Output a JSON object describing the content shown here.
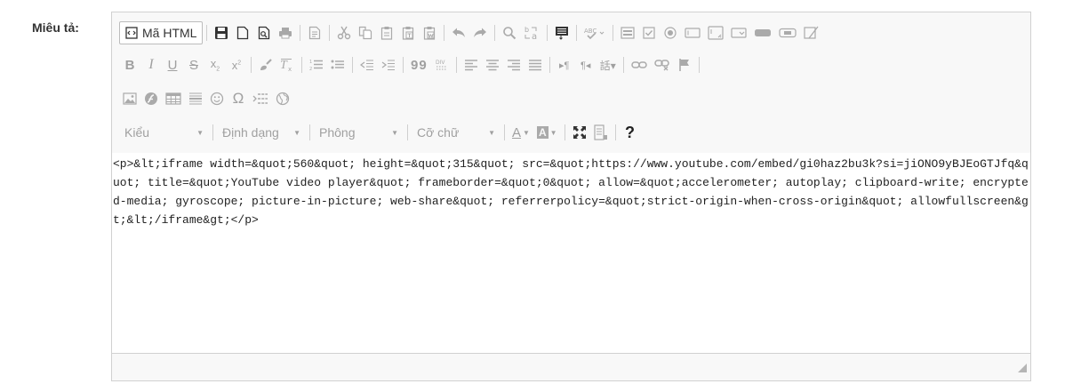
{
  "form": {
    "label": "Miêu tả:"
  },
  "toolbar": {
    "source_label": "Mã HTML",
    "styles_combo": "Kiểu",
    "format_combo": "Định dạng",
    "font_combo": "Phông",
    "size_combo": "Cỡ chữ",
    "help_label": "?",
    "text_color_letter": "A",
    "bg_color_letter": "A",
    "bold": "B",
    "italic": "I",
    "underline": "U",
    "strike": "S",
    "subscript": "x",
    "superscript": "x",
    "omega": "Ω",
    "quote": "99"
  },
  "editor": {
    "content": "<p>&lt;iframe width=&quot;560&quot; height=&quot;315&quot; src=&quot;https://www.youtube.com/embed/gi0haz2bu3k?si=jiONO9yBJEoGTJfq&quot; title=&quot;YouTube video player&quot; frameborder=&quot;0&quot; allow=&quot;accelerometer; autoplay; clipboard-write; encrypted-media; gyroscope; picture-in-picture; web-share&quot; referrerpolicy=&quot;strict-origin-when-cross-origin&quot; allowfullscreen&gt;&lt;/iframe&gt;</p>"
  },
  "icons": [
    "source-icon",
    "save-icon",
    "new-page-icon",
    "preview-icon",
    "print-icon",
    "templates-icon",
    "cut-icon",
    "copy-icon",
    "paste-icon",
    "paste-text-icon",
    "paste-word-icon",
    "undo-icon",
    "redo-icon",
    "find-icon",
    "replace-icon",
    "select-all-icon",
    "spellcheck-icon",
    "form-icon",
    "checkbox-icon",
    "radio-icon",
    "textfield-icon",
    "textarea-icon",
    "select-icon",
    "button-icon",
    "image-button-icon",
    "hidden-field-icon",
    "remove-format-icon",
    "ordered-list-icon",
    "unordered-list-icon",
    "outdent-icon",
    "indent-icon",
    "blockquote-icon",
    "div-icon",
    "align-left-icon",
    "align-center-icon",
    "align-right-icon",
    "justify-icon",
    "ltr-icon",
    "rtl-icon",
    "language-icon",
    "link-icon",
    "unlink-icon",
    "anchor-icon",
    "image-icon",
    "flash-icon",
    "table-icon",
    "horizontal-rule-icon",
    "smiley-icon",
    "special-char-icon",
    "page-break-icon",
    "iframe-icon",
    "text-color-icon",
    "bg-color-icon",
    "maximize-icon",
    "show-blocks-icon",
    "help-icon",
    "resize-icon"
  ]
}
